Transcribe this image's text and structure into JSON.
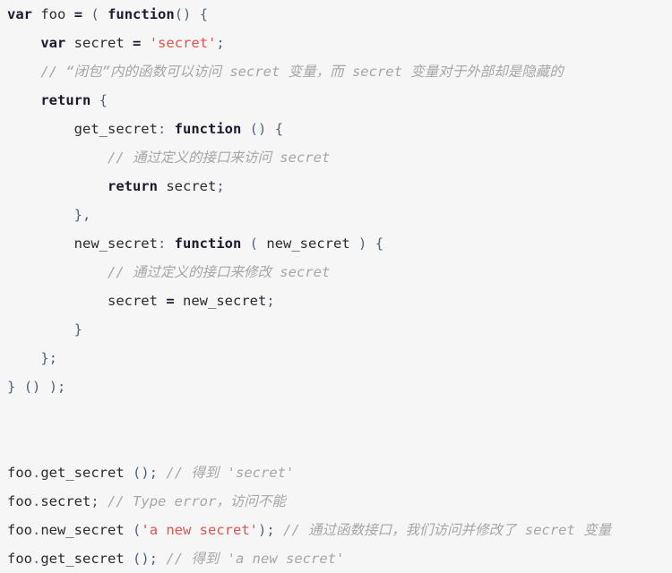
{
  "editor": {
    "language": "javascript",
    "background_color": "#f6f6f6",
    "colors": {
      "keyword": "#1a1a2e",
      "string": "#e0534f",
      "comment": "#a6a6a6",
      "punctuation": "#4f6180",
      "identifier": "#2b2b2b"
    }
  },
  "code": {
    "lines": [
      {
        "indent": 0,
        "tokens": [
          {
            "t": "kw",
            "v": "var"
          },
          {
            "t": "plain",
            "v": " "
          },
          {
            "t": "id",
            "v": "foo"
          },
          {
            "t": "plain",
            "v": " "
          },
          {
            "t": "op",
            "v": "="
          },
          {
            "t": "plain",
            "v": " "
          },
          {
            "t": "punc",
            "v": "("
          },
          {
            "t": "plain",
            "v": " "
          },
          {
            "t": "kw",
            "v": "function"
          },
          {
            "t": "punc",
            "v": "()"
          },
          {
            "t": "plain",
            "v": " "
          },
          {
            "t": "punc",
            "v": "{"
          }
        ]
      },
      {
        "indent": 1,
        "tokens": [
          {
            "t": "kw",
            "v": "var"
          },
          {
            "t": "plain",
            "v": " "
          },
          {
            "t": "id",
            "v": "secret"
          },
          {
            "t": "plain",
            "v": " "
          },
          {
            "t": "op",
            "v": "="
          },
          {
            "t": "plain",
            "v": " "
          },
          {
            "t": "str",
            "v": "'secret'"
          },
          {
            "t": "punc",
            "v": ";"
          }
        ]
      },
      {
        "indent": 1,
        "tokens": [
          {
            "t": "cmt",
            "v": "// “闭包”内的函数可以访问 secret 变量，而 secret 变量对于外部却是隐藏的"
          }
        ]
      },
      {
        "indent": 1,
        "tokens": [
          {
            "t": "kw",
            "v": "return"
          },
          {
            "t": "plain",
            "v": " "
          },
          {
            "t": "punc",
            "v": "{"
          }
        ]
      },
      {
        "indent": 2,
        "tokens": [
          {
            "t": "id",
            "v": "get_secret"
          },
          {
            "t": "punc",
            "v": ":"
          },
          {
            "t": "plain",
            "v": " "
          },
          {
            "t": "kw",
            "v": "function"
          },
          {
            "t": "plain",
            "v": " "
          },
          {
            "t": "punc",
            "v": "()"
          },
          {
            "t": "plain",
            "v": " "
          },
          {
            "t": "punc",
            "v": "{"
          }
        ]
      },
      {
        "indent": 3,
        "tokens": [
          {
            "t": "cmt",
            "v": "// 通过定义的接口来访问 secret"
          }
        ]
      },
      {
        "indent": 3,
        "tokens": [
          {
            "t": "kw",
            "v": "return"
          },
          {
            "t": "plain",
            "v": " "
          },
          {
            "t": "id",
            "v": "secret"
          },
          {
            "t": "punc",
            "v": ";"
          }
        ]
      },
      {
        "indent": 2,
        "tokens": [
          {
            "t": "punc",
            "v": "},"
          }
        ]
      },
      {
        "indent": 2,
        "tokens": [
          {
            "t": "id",
            "v": "new_secret"
          },
          {
            "t": "punc",
            "v": ":"
          },
          {
            "t": "plain",
            "v": " "
          },
          {
            "t": "kw",
            "v": "function"
          },
          {
            "t": "plain",
            "v": " "
          },
          {
            "t": "punc",
            "v": "("
          },
          {
            "t": "plain",
            "v": " "
          },
          {
            "t": "id",
            "v": "new_secret"
          },
          {
            "t": "plain",
            "v": " "
          },
          {
            "t": "punc",
            "v": ")"
          },
          {
            "t": "plain",
            "v": " "
          },
          {
            "t": "punc",
            "v": "{"
          }
        ]
      },
      {
        "indent": 3,
        "tokens": [
          {
            "t": "cmt",
            "v": "// 通过定义的接口来修改 secret"
          }
        ]
      },
      {
        "indent": 3,
        "tokens": [
          {
            "t": "id",
            "v": "secret"
          },
          {
            "t": "plain",
            "v": " "
          },
          {
            "t": "op",
            "v": "="
          },
          {
            "t": "plain",
            "v": " "
          },
          {
            "t": "id",
            "v": "new_secret"
          },
          {
            "t": "punc",
            "v": ";"
          }
        ]
      },
      {
        "indent": 2,
        "tokens": [
          {
            "t": "punc",
            "v": "}"
          }
        ]
      },
      {
        "indent": 1,
        "tokens": [
          {
            "t": "punc",
            "v": "};"
          }
        ]
      },
      {
        "indent": 0,
        "tokens": [
          {
            "t": "punc",
            "v": "}"
          },
          {
            "t": "plain",
            "v": " "
          },
          {
            "t": "punc",
            "v": "()"
          },
          {
            "t": "plain",
            "v": " "
          },
          {
            "t": "punc",
            "v": ");"
          }
        ]
      },
      {
        "indent": 0,
        "tokens": []
      },
      {
        "indent": 0,
        "tokens": []
      },
      {
        "indent": 0,
        "tokens": [
          {
            "t": "id",
            "v": "foo"
          },
          {
            "t": "punc",
            "v": "."
          },
          {
            "t": "id",
            "v": "get_secret"
          },
          {
            "t": "plain",
            "v": " "
          },
          {
            "t": "punc",
            "v": "();"
          },
          {
            "t": "plain",
            "v": " "
          },
          {
            "t": "cmt",
            "v": "// 得到 'secret'"
          }
        ]
      },
      {
        "indent": 0,
        "tokens": [
          {
            "t": "id",
            "v": "foo"
          },
          {
            "t": "punc",
            "v": "."
          },
          {
            "t": "id",
            "v": "secret"
          },
          {
            "t": "punc",
            "v": ";"
          },
          {
            "t": "plain",
            "v": " "
          },
          {
            "t": "cmt",
            "v": "// Type error，访问不能"
          }
        ]
      },
      {
        "indent": 0,
        "tokens": [
          {
            "t": "id",
            "v": "foo"
          },
          {
            "t": "punc",
            "v": "."
          },
          {
            "t": "id",
            "v": "new_secret"
          },
          {
            "t": "plain",
            "v": " "
          },
          {
            "t": "punc",
            "v": "("
          },
          {
            "t": "str",
            "v": "'a new secret'"
          },
          {
            "t": "punc",
            "v": ");"
          },
          {
            "t": "plain",
            "v": " "
          },
          {
            "t": "cmt",
            "v": "// 通过函数接口，我们访问并修改了 secret 变量"
          }
        ]
      },
      {
        "indent": 0,
        "tokens": [
          {
            "t": "id",
            "v": "foo"
          },
          {
            "t": "punc",
            "v": "."
          },
          {
            "t": "id",
            "v": "get_secret"
          },
          {
            "t": "plain",
            "v": " "
          },
          {
            "t": "punc",
            "v": "();"
          },
          {
            "t": "plain",
            "v": " "
          },
          {
            "t": "cmt",
            "v": "// 得到 'a new secret'"
          }
        ]
      }
    ]
  }
}
